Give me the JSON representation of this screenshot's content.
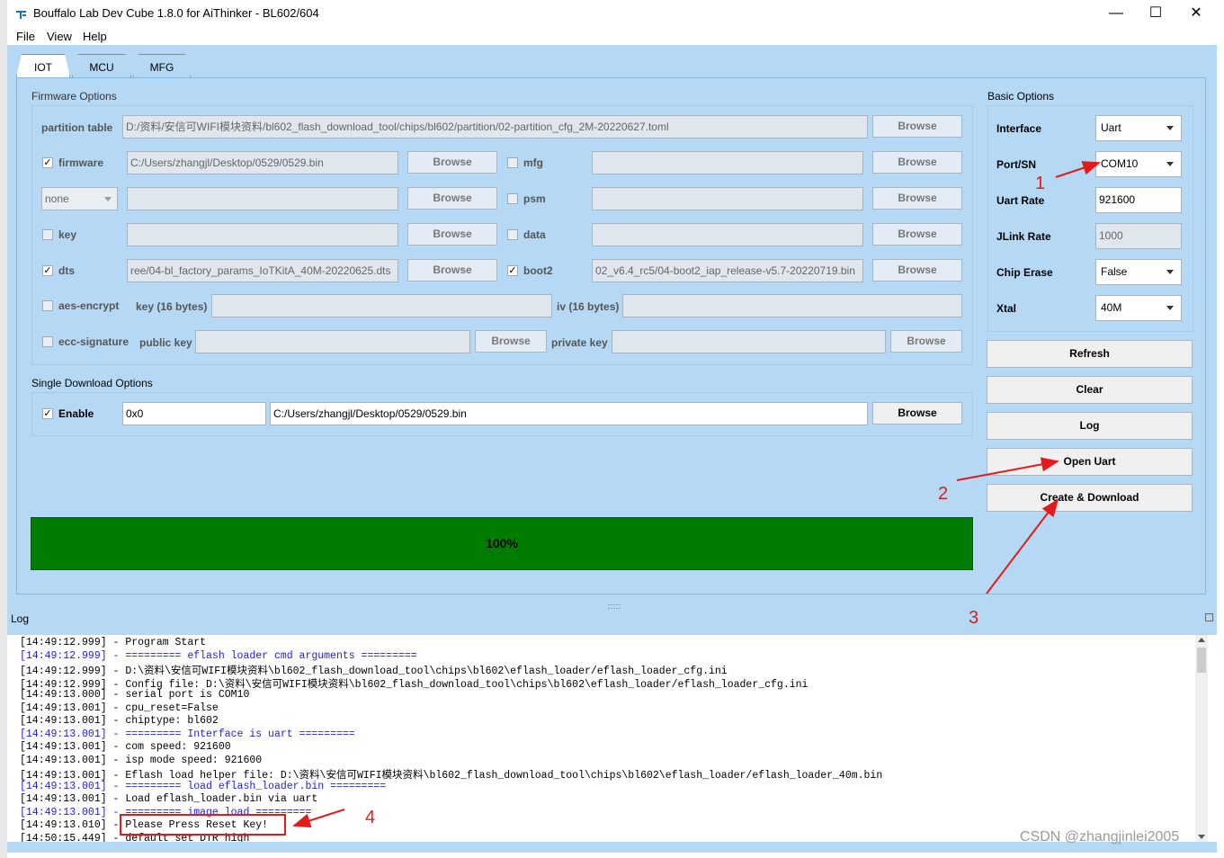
{
  "window": {
    "title": "Bouffalo Lab Dev Cube 1.8.0 for AiThinker - BL602/604",
    "minimize": "—",
    "maximize": "☐",
    "close": "✕"
  },
  "menu": {
    "file": "File",
    "view": "View",
    "help": "Help"
  },
  "tabs": [
    {
      "label": "IOT"
    },
    {
      "label": "MCU"
    },
    {
      "label": "MFG"
    }
  ],
  "firmware": {
    "group_label": "Firmware Options",
    "partition_label": "partition table",
    "partition_value": "D:/资料/安信可WIFI模块资料/bl602_flash_download_tool/chips/bl602/partition/02-partition_cfg_2M-20220627.toml",
    "browse": "Browse",
    "firmware_label": "firmware",
    "firmware_value": "C:/Users/zhangjl/Desktop/0529/0529.bin",
    "mfg_label": "mfg",
    "none_select": "none",
    "psm_label": "psm",
    "key_label": "key",
    "data_label": "data",
    "dts_label": "dts",
    "dts_value": "ree/04-bl_factory_params_IoTKitA_40M-20220625.dts",
    "boot2_label": "boot2",
    "boot2_value": "02_v6.4_rc5/04-boot2_iap_release-v5.7-20220719.bin",
    "aes_label": "aes-encrypt",
    "aes_key_label": "key (16 bytes)",
    "aes_iv_label": "iv (16 bytes)",
    "ecc_label": "ecc-signature",
    "public_key_label": "public key",
    "private_key_label": "private key",
    "check": "✓"
  },
  "single": {
    "group_label": "Single Download Options",
    "enable_label": "Enable",
    "address": "0x0",
    "path": "C:/Users/zhangjl/Desktop/0529/0529.bin",
    "browse": "Browse"
  },
  "basic": {
    "group_label": "Basic Options",
    "interface_label": "Interface",
    "interface_value": "Uart",
    "port_label": "Port/SN",
    "port_value": "COM10",
    "uart_rate_label": "Uart Rate",
    "uart_rate_value": "921600",
    "jlink_label": "JLink Rate",
    "jlink_value": "1000",
    "erase_label": "Chip Erase",
    "erase_value": "False",
    "xtal_label": "Xtal",
    "xtal_value": "40M"
  },
  "actions": {
    "refresh": "Refresh",
    "clear": "Clear",
    "log": "Log",
    "open_uart": "Open Uart",
    "create_download": "Create & Download"
  },
  "progress": {
    "label": "100%",
    "value": 1.0
  },
  "log": {
    "label": "Log",
    "lines": [
      {
        "text": "[14:49:12.999] - Program Start",
        "blue": false
      },
      {
        "text": "[14:49:12.999] - ========= eflash loader cmd arguments =========",
        "blue": true
      },
      {
        "text": "[14:49:12.999] - D:\\资料\\安信可WIFI模块资料\\bl602_flash_download_tool\\chips\\bl602\\eflash_loader/eflash_loader_cfg.ini",
        "blue": false
      },
      {
        "text": "[14:49:12.999] - Config file: D:\\资料\\安信可WIFI模块资料\\bl602_flash_download_tool\\chips\\bl602\\eflash_loader/eflash_loader_cfg.ini",
        "blue": false
      },
      {
        "text": "[14:49:13.000] - serial port is COM10",
        "blue": false
      },
      {
        "text": "[14:49:13.001] - cpu_reset=False",
        "blue": false
      },
      {
        "text": "[14:49:13.001] - chiptype: bl602",
        "blue": false
      },
      {
        "text": "[14:49:13.001] - ========= Interface is uart =========",
        "blue": true
      },
      {
        "text": "[14:49:13.001] - com speed: 921600",
        "blue": false
      },
      {
        "text": "[14:49:13.001] - isp mode speed: 921600",
        "blue": false
      },
      {
        "text": "[14:49:13.001] - Eflash load helper file: D:\\资料\\安信可WIFI模块资料\\bl602_flash_download_tool\\chips\\bl602\\eflash_loader/eflash_loader_40m.bin",
        "blue": false
      },
      {
        "text": "[14:49:13.001] - ========= load eflash_loader.bin =========",
        "blue": true
      },
      {
        "text": "[14:49:13.001] - Load eflash_loader.bin via uart",
        "blue": false
      },
      {
        "text": "[14:49:13.001] - ========= image load =========",
        "blue": true
      },
      {
        "text": "[14:49:13.010] - Please Press Reset Key!",
        "blue": false
      },
      {
        "text": "[14:50:15.449] - default set DTR high",
        "blue": false
      }
    ]
  },
  "annotations": {
    "n1": "1",
    "n2": "2",
    "n3": "3",
    "n4": "4"
  },
  "watermark": "CSDN @zhangjinlei2005",
  "colors": {
    "panel": "#b5d9f4",
    "progress": "#007c00",
    "annotation": "#e21b1b",
    "log_blue": "#1e1edc"
  }
}
